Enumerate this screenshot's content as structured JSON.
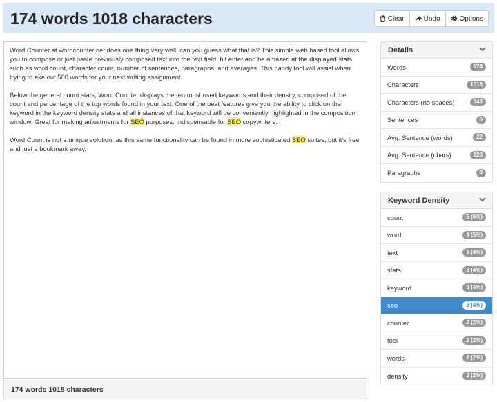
{
  "header": {
    "title": "174 words 1018 characters",
    "buttons": {
      "clear": "Clear",
      "undo": "Undo",
      "options": "Options"
    }
  },
  "editor": {
    "segments": [
      [
        {
          "t": "Word Counter at wordcounter.net does one thing very well, can you guess what that is? This simple web based tool allows you to compose or just paste previously composed text into the text field, hit enter and be amazed at the displayed stats such as word count, character count, number of sentences, paragraphs, and averages. This handy tool will assist when trying to eke out 500 words for your next writing assignment."
        }
      ],
      [
        {
          "t": "Below the general count stats, Word Counter displays the ten most used keywords and their density, comprised of the count and percentage of the top words found in your text. One of the best features give you the ability to click on the keyword in the keyword density stats and all instances of that keyword will be conveniently highlighted in the composition window. Great for making adjustments for "
        },
        {
          "t": "SEO",
          "h": true
        },
        {
          "t": " purposes. Indispensable for "
        },
        {
          "t": "SEO",
          "h": true
        },
        {
          "t": " copywriters."
        }
      ],
      [
        {
          "t": "Word Count is not a unique solution, as this same functionality can be found in more sophisticated "
        },
        {
          "t": "SEO",
          "h": true
        },
        {
          "t": " suites, but it's free and just a bookmark away."
        }
      ]
    ]
  },
  "footer": {
    "summary": "174 words 1018 characters"
  },
  "details": {
    "title": "Details",
    "items": [
      {
        "label": "Words",
        "value": "174"
      },
      {
        "label": "Characters",
        "value": "1018"
      },
      {
        "label": "Characters (no spaces)",
        "value": "848"
      },
      {
        "label": "Sentences",
        "value": "6"
      },
      {
        "label": "Avg. Sentence (words)",
        "value": "22"
      },
      {
        "label": "Avg. Sentence (chars)",
        "value": "128"
      },
      {
        "label": "Paragraphs",
        "value": "3"
      }
    ]
  },
  "keywords": {
    "title": "Keyword Density",
    "selected": "seo",
    "items": [
      {
        "label": "count",
        "value": "5 (6%)"
      },
      {
        "label": "word",
        "value": "4 (5%)"
      },
      {
        "label": "text",
        "value": "3 (4%)"
      },
      {
        "label": "stats",
        "value": "3 (4%)"
      },
      {
        "label": "keyword",
        "value": "3 (4%)"
      },
      {
        "label": "seo",
        "value": "3 (4%)"
      },
      {
        "label": "counter",
        "value": "2 (2%)"
      },
      {
        "label": "tool",
        "value": "2 (2%)"
      },
      {
        "label": "words",
        "value": "2 (2%)"
      },
      {
        "label": "density",
        "value": "2 (2%)"
      }
    ]
  },
  "colors": {
    "header_bg": "#d9e9f7",
    "accent": "#428bca",
    "highlight": "#fff35c",
    "badge": "#999999"
  }
}
